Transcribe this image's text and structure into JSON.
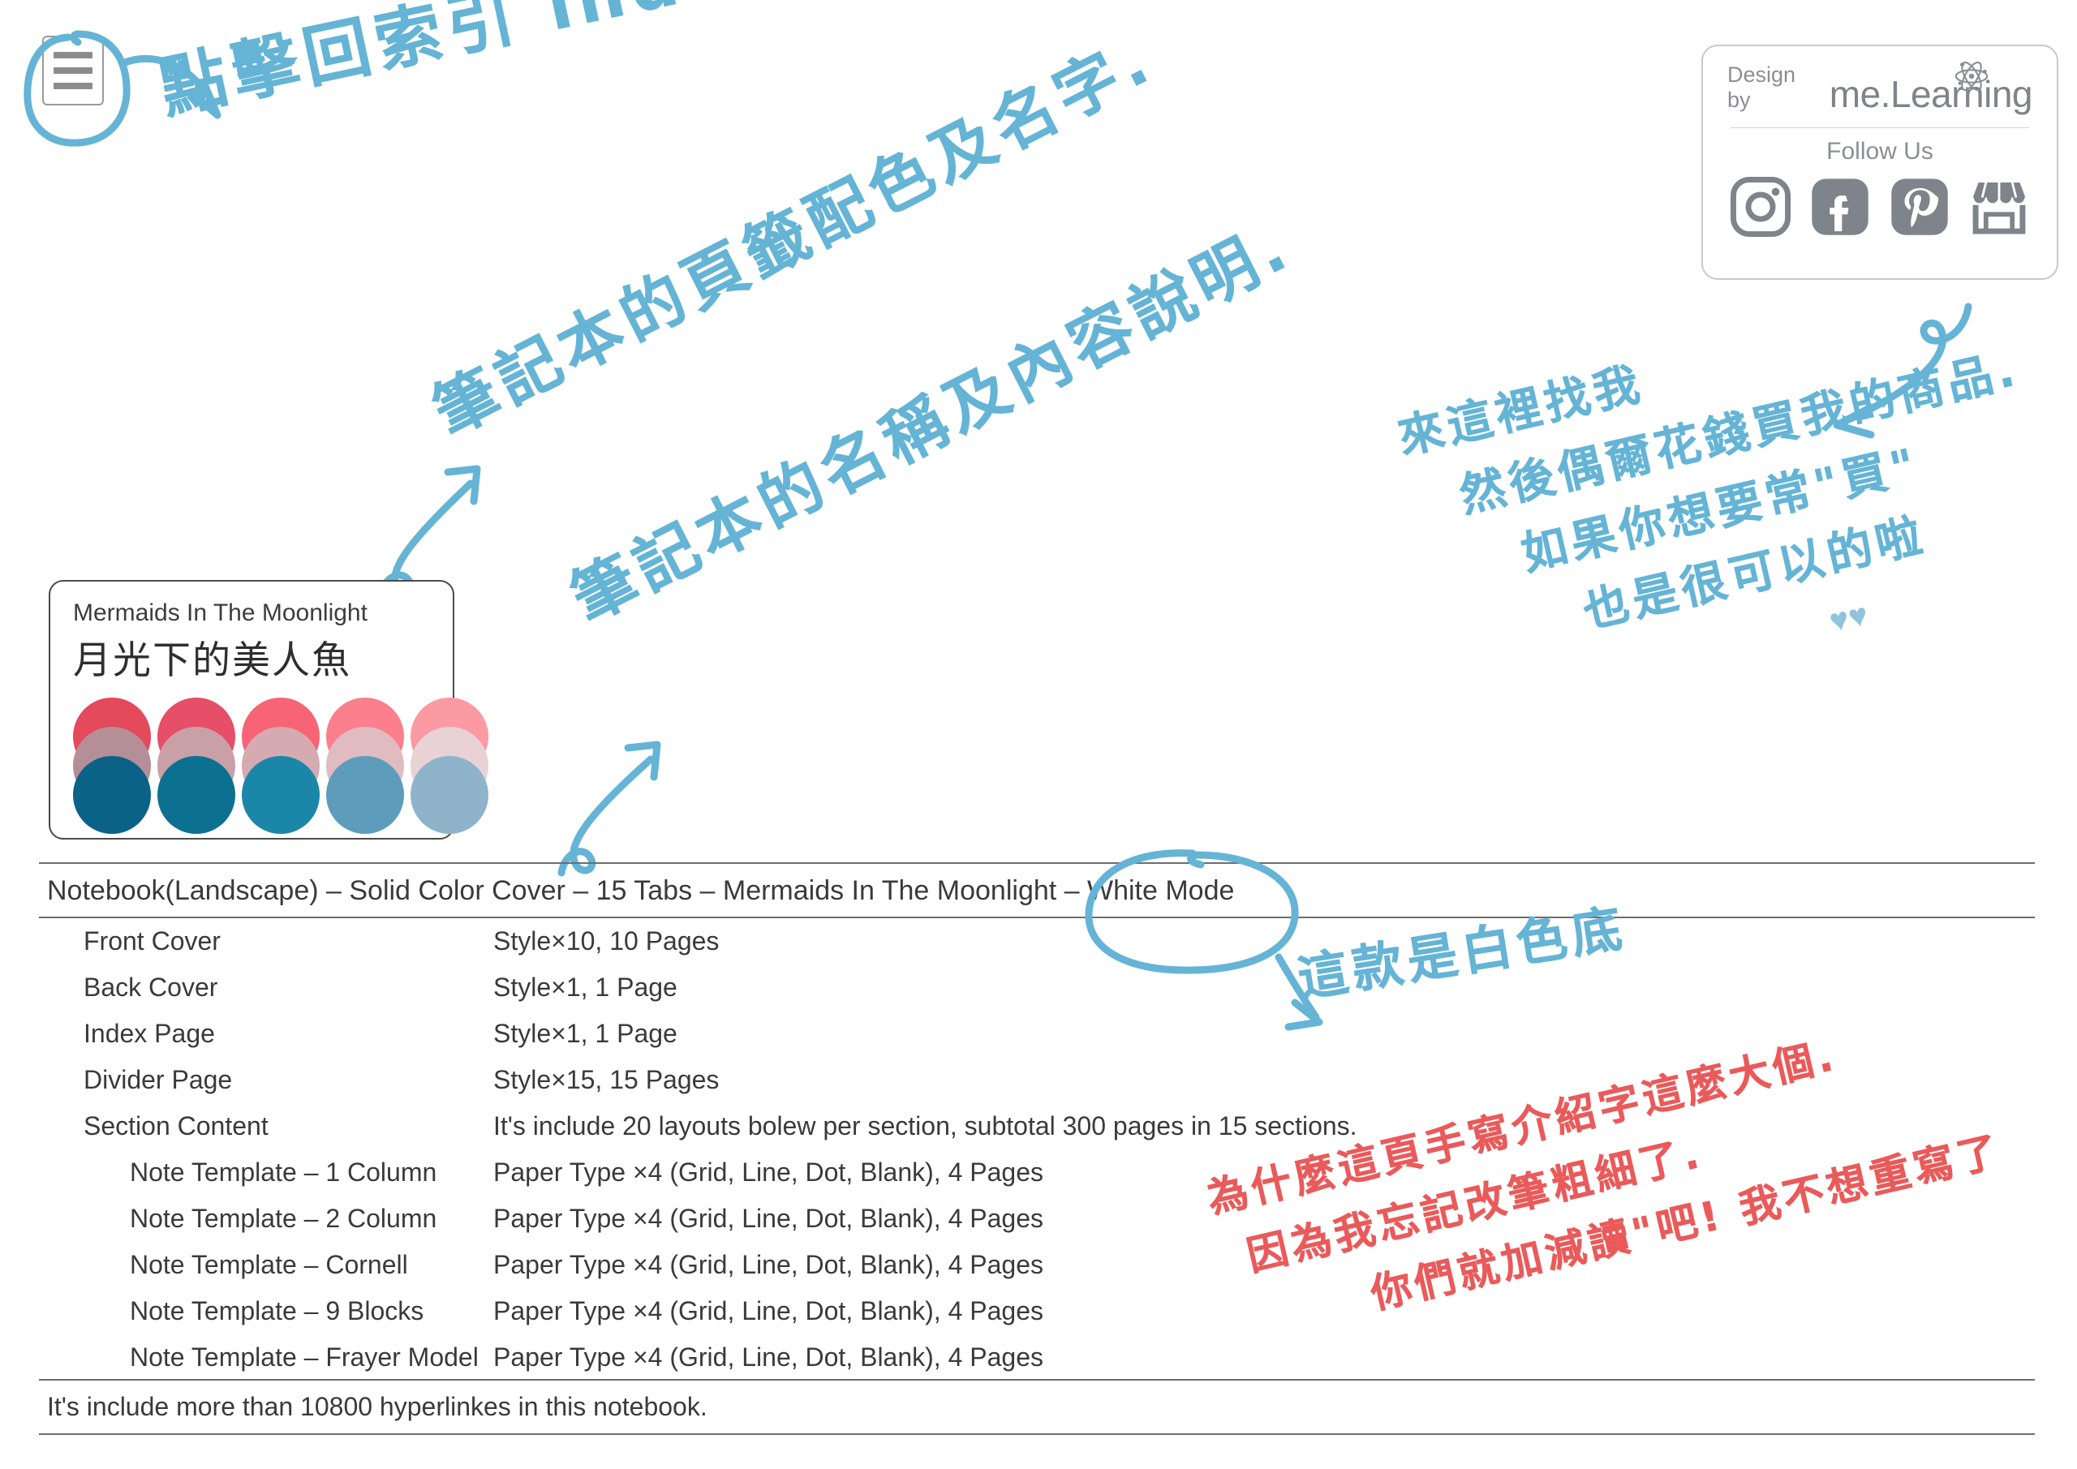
{
  "index_icon": {
    "name": "index-icon"
  },
  "annotations": {
    "click_index": "點擊回索引 index",
    "tab_color": "筆記本的頁籤配色及名字.",
    "name_info": "筆記本的名稱及內容說明.",
    "find_me_1": "來這裡找我",
    "find_me_2": "然後偶爾花錢買我的商品.",
    "find_me_3": "如果你想要常\"買\"",
    "find_me_4": "也是很可以的啦",
    "hearts": "♥♥",
    "white_mode_note": "這款是白色底",
    "why_1": "為什麼這頁手寫介紹字這麼大個.",
    "why_2": "因為我忘記改筆粗細了.",
    "why_3": "你們就加減讀\"吧! 我不想重寫了"
  },
  "brand_card": {
    "design_by": "Design by",
    "brand_name": "me.Learning",
    "follow_us": "Follow Us",
    "atom_icon": "atom-icon",
    "socials": [
      {
        "name": "instagram-icon"
      },
      {
        "name": "facebook-icon"
      },
      {
        "name": "pinterest-icon"
      },
      {
        "name": "shop-icon"
      }
    ]
  },
  "palette": {
    "title_en": "Mermaids In The Moonlight",
    "title_zh": "月光下的美人魚",
    "columns": [
      {
        "top": "#e4495c",
        "mid": "#b58f97",
        "bottom": "#0b6289"
      },
      {
        "top": "#e74e67",
        "mid": "#c9a0a6",
        "bottom": "#0c7191"
      },
      {
        "top": "#f76476",
        "mid": "#d5aab0",
        "bottom": "#1b87a8"
      },
      {
        "top": "#fb7f8c",
        "mid": "#e0bcc0",
        "bottom": "#5d9dbb"
      },
      {
        "top": "#fc9aa4",
        "mid": "#e9d2d6",
        "bottom": "#8fb4c9"
      }
    ]
  },
  "spec": {
    "title": "Notebook(Landscape) – Solid Color Cover – 15 Tabs – Mermaids In The Moonlight – White Mode",
    "rows": [
      {
        "key": "Front Cover",
        "value": "Style×10, 10 Pages",
        "sub": false
      },
      {
        "key": "Back Cover",
        "value": "Style×1, 1 Page",
        "sub": false
      },
      {
        "key": "Index Page",
        "value": "Style×1, 1 Page",
        "sub": false
      },
      {
        "key": "Divider Page",
        "value": "Style×15, 15 Pages",
        "sub": false
      },
      {
        "key": "Section Content",
        "value": "It's include 20 layouts bolew per section, subtotal 300 pages in 15 sections.",
        "sub": false
      },
      {
        "key": "Note Template – 1 Column",
        "value": "Paper Type ×4 (Grid, Line, Dot, Blank), 4 Pages",
        "sub": true
      },
      {
        "key": "Note Template – 2 Column",
        "value": "Paper Type ×4 (Grid, Line, Dot, Blank), 4 Pages",
        "sub": true
      },
      {
        "key": "Note Template – Cornell",
        "value": "Paper Type ×4 (Grid, Line, Dot, Blank), 4 Pages",
        "sub": true
      },
      {
        "key": "Note Template – 9 Blocks",
        "value": "Paper Type ×4 (Grid, Line, Dot, Blank), 4 Pages",
        "sub": true
      },
      {
        "key": "Note Template – Frayer Model",
        "value": "Paper Type ×4 (Grid, Line, Dot, Blank), 4 Pages",
        "sub": true
      }
    ],
    "footer": "It's include more than 10800 hyperlinkes in this notebook."
  },
  "colors": {
    "ink_blue": "#65b4d6",
    "ink_red": "#ea5a5a",
    "text_gray": "#3a3a3a",
    "icon_gray": "#7e848a"
  }
}
